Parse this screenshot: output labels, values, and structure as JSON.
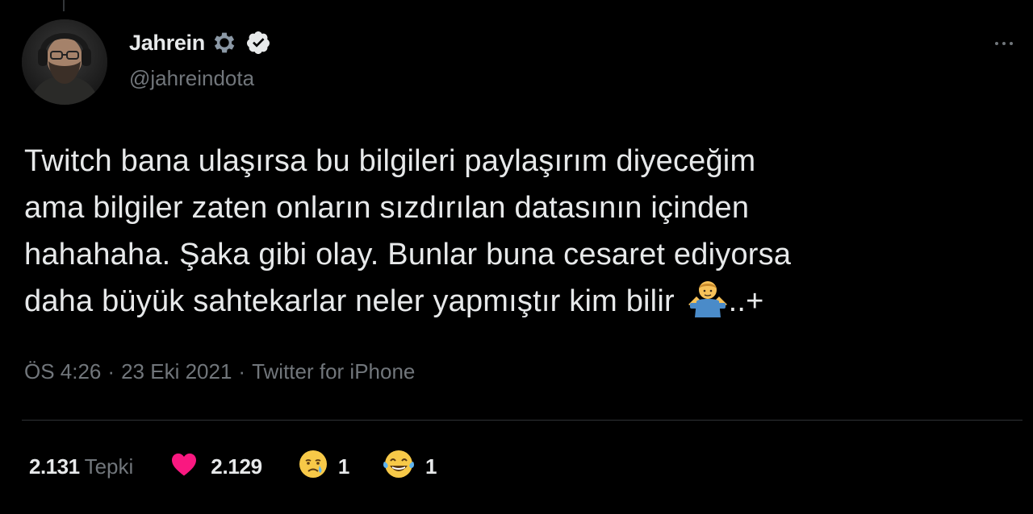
{
  "author": {
    "display_name": "Jahrein",
    "handle": "@jahreindota",
    "avatar_icon": "profile-photo",
    "badges": [
      "gear-icon",
      "verified-icon"
    ]
  },
  "tweet": {
    "lines": [
      "Twitch bana ulaşırsa bu bilgileri paylaşırım diyeceğim",
      "ama bilgiler zaten onların sızdırılan datasının içinden",
      "hahahaha. Şaka gibi olay. Bunlar buna cesaret ediyorsa",
      "daha büyük sahtekarlar neler yapmıştır kim bilir"
    ],
    "trailing_emoji": "man-shrugging-emoji",
    "more_text": "..+"
  },
  "meta": {
    "time": "ÖS 4:26",
    "separator": "·",
    "date": "23 Eki 2021",
    "source": "Twitter for iPhone"
  },
  "reactions": {
    "total_count": "2.131",
    "total_label": "Tepki",
    "items": [
      {
        "icon": "heart-icon",
        "count": "2.129",
        "color": "#f91880"
      },
      {
        "icon": "crying-face-emoji",
        "count": "1"
      },
      {
        "icon": "tears-of-joy-emoji",
        "count": "1"
      }
    ]
  },
  "colors": {
    "background": "#000000",
    "text_primary": "#e7e9ea",
    "text_secondary": "#71767b",
    "divider": "#2f3336",
    "heart": "#f91880"
  }
}
